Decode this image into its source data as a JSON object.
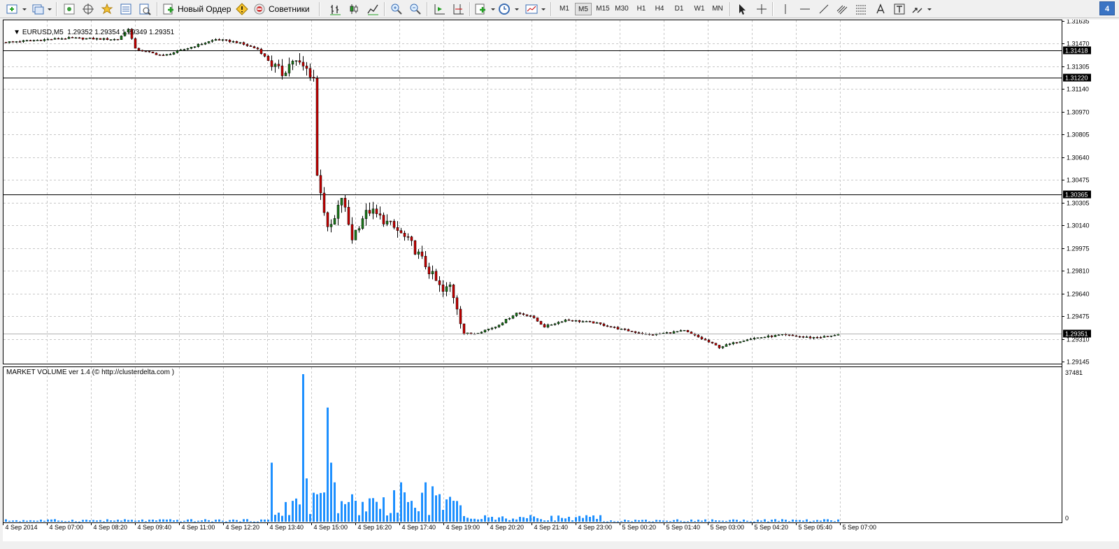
{
  "toolbar": {
    "new_order_label": "Новый Ордер",
    "experts_label": "Советники",
    "timeframes": [
      "M1",
      "M5",
      "M15",
      "M30",
      "H1",
      "H4",
      "D1",
      "W1",
      "MN"
    ],
    "active_timeframe": "M5",
    "badge": "4"
  },
  "chart": {
    "symbol_label": "EURUSD,M5",
    "ohlc_label": "1.29352 1.29354 1.29349 1.29351",
    "price_ticks": [
      "1.31635",
      "1.31470",
      "1.31305",
      "1.31140",
      "1.30970",
      "1.30805",
      "1.30640",
      "1.30475",
      "1.30305",
      "1.30140",
      "1.29975",
      "1.29810",
      "1.29640",
      "1.29475",
      "1.29310",
      "1.29145"
    ],
    "hlines": [
      {
        "price": 1.31418,
        "label": "1.31418"
      },
      {
        "price": 1.3122,
        "label": "1.31220"
      },
      {
        "price": 1.30365,
        "label": "1.30365"
      }
    ],
    "current_price": "1.29351",
    "price_line_color": "#000000",
    "bull_color": "#1a7a1a",
    "bear_color": "#c80000",
    "grid_color": "#c8c8c8"
  },
  "indicator": {
    "title": "MARKET VOLUME ver 1.4 (© http://clusterdelta.com )",
    "max_label": "37481",
    "zero_label": "0",
    "bar_color": "#1e90ff"
  },
  "time_axis": [
    "4 Sep 2014",
    "4 Sep 07:00",
    "4 Sep 08:20",
    "4 Sep 09:40",
    "4 Sep 11:00",
    "4 Sep 12:20",
    "4 Sep 13:40",
    "4 Sep 15:00",
    "4 Sep 16:20",
    "4 Sep 17:40",
    "4 Sep 19:00",
    "4 Sep 20:20",
    "4 Sep 21:40",
    "4 Sep 23:00",
    "5 Sep 00:20",
    "5 Sep 01:40",
    "5 Sep 03:00",
    "5 Sep 04:20",
    "5 Sep 05:40",
    "5 Sep 07:00"
  ],
  "chart_data": {
    "type": "candlestick",
    "title": "EURUSD,M5",
    "timeframe": "M5",
    "price_range": [
      1.29145,
      1.31635
    ],
    "path_points": [
      [
        0,
        1.3148
      ],
      [
        18,
        1.3151
      ],
      [
        32,
        1.315
      ],
      [
        35,
        1.3158
      ],
      [
        37,
        1.3143
      ],
      [
        45,
        1.3138
      ],
      [
        55,
        1.3146
      ],
      [
        60,
        1.315
      ],
      [
        66,
        1.3148
      ],
      [
        72,
        1.3143
      ],
      [
        76,
        1.3132
      ],
      [
        79,
        1.3125
      ],
      [
        82,
        1.3135
      ],
      [
        86,
        1.3128
      ],
      [
        88,
        1.3122
      ],
      [
        89,
        1.305
      ],
      [
        90,
        1.304
      ],
      [
        92,
        1.301
      ],
      [
        94,
        1.3018
      ],
      [
        96,
        1.3035
      ],
      [
        99,
        1.3005
      ],
      [
        102,
        1.302
      ],
      [
        104,
        1.3025
      ],
      [
        108,
        1.3018
      ],
      [
        112,
        1.301
      ],
      [
        116,
        1.3
      ],
      [
        120,
        1.2985
      ],
      [
        125,
        1.2965
      ],
      [
        127,
        1.297
      ],
      [
        129,
        1.2955
      ],
      [
        131,
        1.2935
      ],
      [
        134,
        1.2935
      ],
      [
        140,
        1.294
      ],
      [
        146,
        1.295
      ],
      [
        150,
        1.2948
      ],
      [
        154,
        1.294
      ],
      [
        160,
        1.2945
      ],
      [
        168,
        1.2943
      ],
      [
        176,
        1.2938
      ],
      [
        184,
        1.2934
      ],
      [
        194,
        1.2937
      ],
      [
        200,
        1.293
      ],
      [
        204,
        1.2925
      ],
      [
        212,
        1.2931
      ],
      [
        222,
        1.2934
      ],
      [
        230,
        1.2932
      ],
      [
        236,
        1.2933
      ],
      [
        238,
        1.29351
      ]
    ],
    "volume_spikes": [
      [
        76,
        15000
      ],
      [
        80,
        5000
      ],
      [
        85,
        37481
      ],
      [
        86,
        11000
      ],
      [
        92,
        29000
      ],
      [
        93,
        15000
      ],
      [
        94,
        10000
      ],
      [
        98,
        5000
      ],
      [
        105,
        6000
      ],
      [
        111,
        8000
      ],
      [
        113,
        10000
      ],
      [
        115,
        5000
      ],
      [
        120,
        10000
      ],
      [
        122,
        9000
      ],
      [
        124,
        7000
      ]
    ],
    "volume_range": [
      0,
      37481
    ]
  }
}
